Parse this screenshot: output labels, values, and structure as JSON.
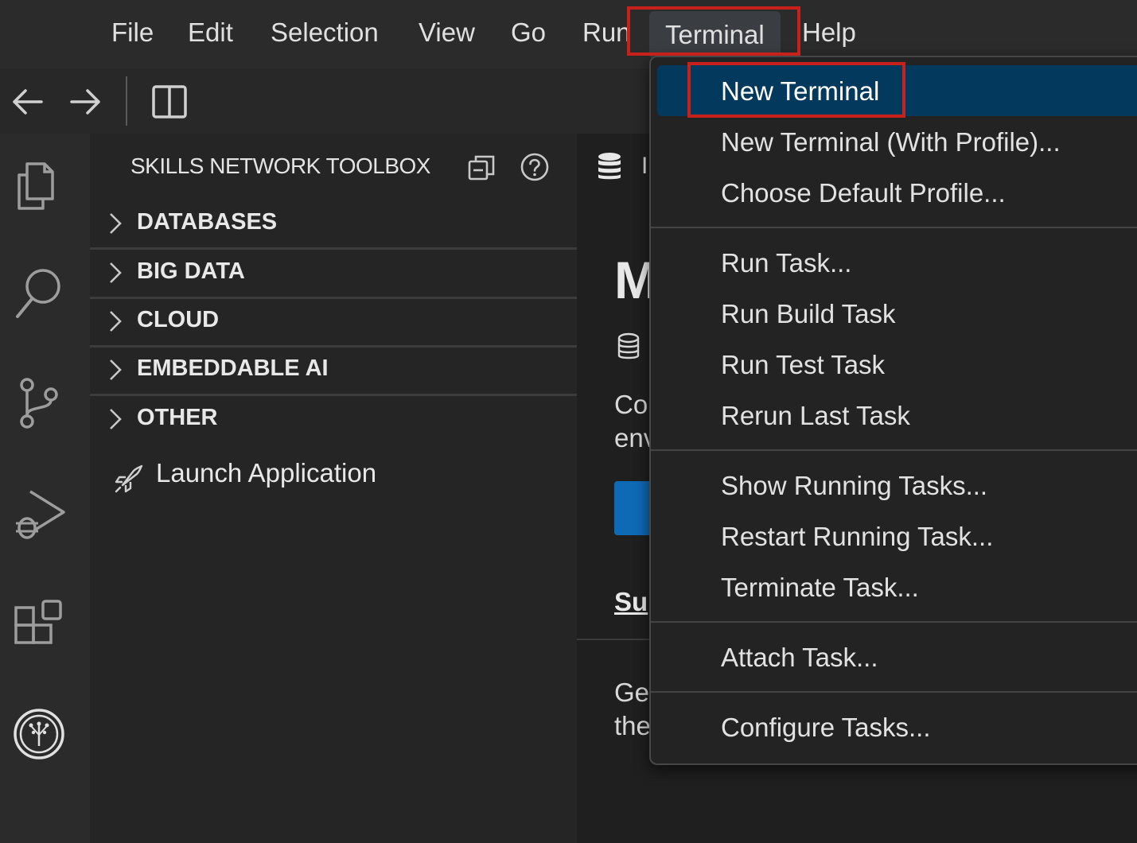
{
  "menubar": {
    "items": [
      "File",
      "Edit",
      "Selection",
      "View",
      "Go",
      "Run",
      "Terminal",
      "Help"
    ],
    "active": "Terminal"
  },
  "sidebar": {
    "title": "SKILLS NETWORK TOOLBOX",
    "sections": [
      "DATABASES",
      "BIG DATA",
      "CLOUD",
      "EMBEDDABLE AI",
      "OTHER"
    ],
    "launch_label": "Launch Application"
  },
  "editor": {
    "tab_initial": "I",
    "heading_fragment": "M",
    "para1_line1": "Co",
    "para1_line2": "env",
    "link_fragment": "Su",
    "para2_line1": "Ge",
    "para2_line2": "the"
  },
  "terminal_menu": {
    "groups": [
      [
        "New Terminal",
        "New Terminal (With Profile)...",
        "Choose Default Profile..."
      ],
      [
        "Run Task...",
        "Run Build Task",
        "Run Test Task",
        "Rerun Last Task"
      ],
      [
        "Show Running Tasks...",
        "Restart Running Task...",
        "Terminate Task..."
      ],
      [
        "Attach Task..."
      ],
      [
        "Configure Tasks..."
      ]
    ],
    "highlighted": "New Terminal"
  },
  "colors": {
    "highlight_box": "#c8201b",
    "menu_selection": "#04395e",
    "button_blue": "#0f6ab5"
  },
  "icons": [
    "back-arrow-icon",
    "forward-arrow-icon",
    "split-editor-icon",
    "explorer-icon",
    "search-icon",
    "source-control-icon",
    "run-debug-icon",
    "extensions-icon",
    "skills-network-icon",
    "collapse-all-icon",
    "help-icon",
    "chevron-right-icon",
    "rocket-icon",
    "database-icon"
  ]
}
